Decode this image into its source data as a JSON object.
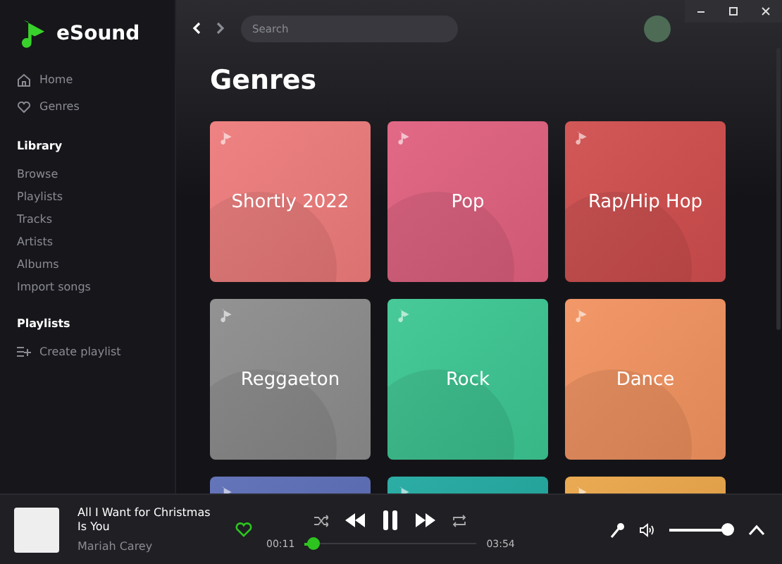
{
  "app": {
    "name": "eSound"
  },
  "sidebar": {
    "nav": [
      {
        "label": "Home",
        "kind": "home"
      },
      {
        "label": "Genres",
        "kind": "heart"
      }
    ],
    "sections": [
      {
        "title": "Library",
        "items": [
          {
            "label": "Browse",
            "kind": "text"
          },
          {
            "label": "Playlists",
            "kind": "text"
          },
          {
            "label": "Tracks",
            "kind": "text"
          },
          {
            "label": "Artists",
            "kind": "text"
          },
          {
            "label": "Albums",
            "kind": "text"
          },
          {
            "label": "Import songs",
            "kind": "text"
          }
        ]
      },
      {
        "title": "Playlists",
        "items": [
          {
            "label": "Create playlist",
            "kind": "add-list"
          }
        ]
      }
    ]
  },
  "search": {
    "placeholder": "Search"
  },
  "page": {
    "title": "Genres",
    "genres": [
      {
        "label": "Shortly 2022",
        "color": "#ee7b7b"
      },
      {
        "label": "Pop",
        "color": "#e0607f"
      },
      {
        "label": "Rap/Hip Hop",
        "color": "#d04d4d"
      },
      {
        "label": "Reggaeton",
        "color": "#8c8c8c"
      },
      {
        "label": "Rock",
        "color": "#3cc692"
      },
      {
        "label": "Dance",
        "color": "#f2925f"
      },
      {
        "color": "#5b6cb5"
      },
      {
        "color": "#1fa89f"
      },
      {
        "color": "#e9a548"
      }
    ]
  },
  "player": {
    "title": "All I Want for Christmas Is You",
    "artist": "Mariah Carey",
    "liked": true,
    "playing": true,
    "elapsed": "00:11",
    "duration": "03:54",
    "progress": {
      "level": 0.05
    },
    "volume": {
      "level": 0.9
    }
  }
}
